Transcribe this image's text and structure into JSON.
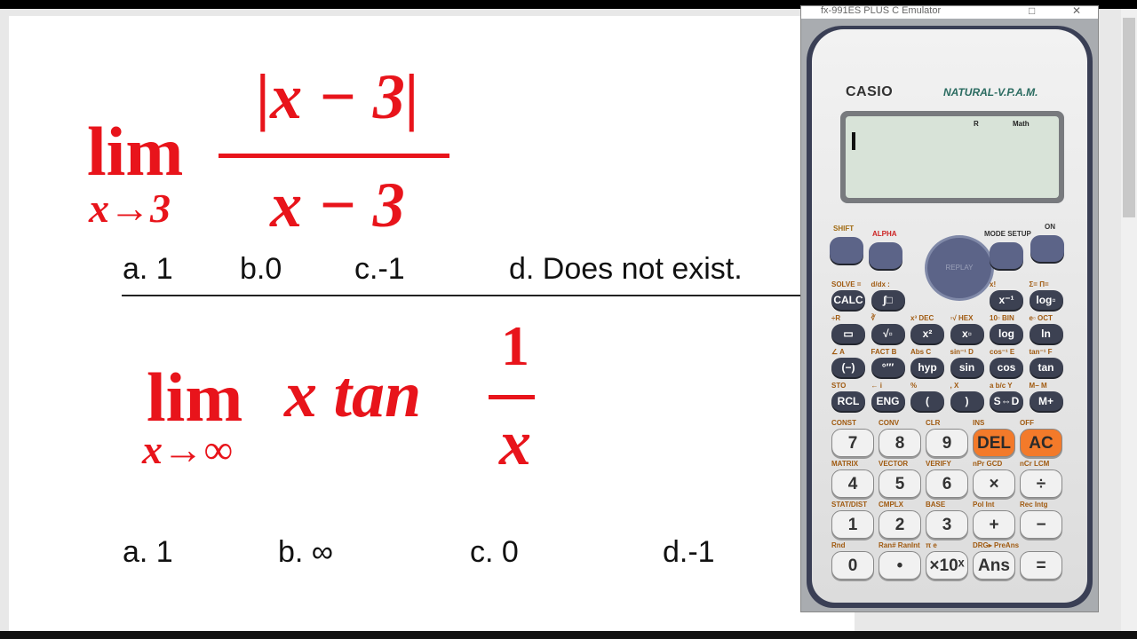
{
  "document": {
    "q1": {
      "lim": "lim",
      "sub": "x→3",
      "numerator": "|x − 3|",
      "denominator": "x − 3",
      "options": [
        "a. 1",
        "b.0",
        "c.-1",
        "d. Does not exist."
      ]
    },
    "q2": {
      "lim": "lim",
      "sub": "x→∞",
      "expr": "x tan",
      "numerator": "1",
      "denominator": "x",
      "options": [
        "a. 1",
        "b. ∞",
        "c. 0",
        "d.-1"
      ]
    },
    "accent_color": "#e8141b"
  },
  "emulator": {
    "title": "fx-991ES PLUS C Emulator",
    "brand": "CASIO",
    "series": "NATURAL-V.P.A.M.",
    "indicators": [
      "R",
      "Math"
    ],
    "top": {
      "shift": "SHIFT",
      "alpha": "ALPHA",
      "mode": "MODE SETUP",
      "on": "ON",
      "replay": "REPLAY"
    },
    "fn_rows": [
      [
        {
          "k": "CALC",
          "s": "SOLVE ="
        },
        {
          "k": "∫□",
          "s": "d/dx :"
        },
        {
          "k": "x⁻¹",
          "s": "x!"
        },
        {
          "k": "log▫",
          "s": "Σ= Π="
        }
      ],
      [
        {
          "k": "▭",
          "s": "÷R"
        },
        {
          "k": "√▫",
          "s": "∛"
        },
        {
          "k": "x²",
          "s": "x³ DEC"
        },
        {
          "k": "x▫",
          "s": "▫√ HEX"
        },
        {
          "k": "log",
          "s": "10▫ BIN"
        },
        {
          "k": "ln",
          "s": "e▫ OCT"
        }
      ],
      [
        {
          "k": "(−)",
          "s": "∠ A"
        },
        {
          "k": "°′″",
          "s": "FACT B"
        },
        {
          "k": "hyp",
          "s": "Abs C"
        },
        {
          "k": "sin",
          "s": "sin⁻¹ D"
        },
        {
          "k": "cos",
          "s": "cos⁻¹ E"
        },
        {
          "k": "tan",
          "s": "tan⁻¹ F"
        }
      ],
      [
        {
          "k": "RCL",
          "s": "STO"
        },
        {
          "k": "ENG",
          "s": "← i"
        },
        {
          "k": "(",
          "s": "%"
        },
        {
          "k": ")",
          "s": ", X"
        },
        {
          "k": "S⇔D",
          "s": "a b/c Y"
        },
        {
          "k": "M+",
          "s": "M− M"
        }
      ]
    ],
    "num_rows": [
      [
        {
          "k": "7",
          "s": "CONST"
        },
        {
          "k": "8",
          "s": "CONV"
        },
        {
          "k": "9",
          "s": "CLR"
        },
        {
          "k": "DEL",
          "s": "INS",
          "o": 1
        },
        {
          "k": "AC",
          "s": "OFF",
          "o": 1
        }
      ],
      [
        {
          "k": "4",
          "s": "MATRIX"
        },
        {
          "k": "5",
          "s": "VECTOR"
        },
        {
          "k": "6",
          "s": "VERIFY"
        },
        {
          "k": "×",
          "s": "nPr GCD"
        },
        {
          "k": "÷",
          "s": "nCr LCM"
        }
      ],
      [
        {
          "k": "1",
          "s": "STAT/DIST"
        },
        {
          "k": "2",
          "s": "CMPLX"
        },
        {
          "k": "3",
          "s": "BASE"
        },
        {
          "k": "+",
          "s": "Pol Int"
        },
        {
          "k": "−",
          "s": "Rec Intg"
        }
      ],
      [
        {
          "k": "0",
          "s": "Rnd"
        },
        {
          "k": "•",
          "s": "Ran# RanInt"
        },
        {
          "k": "×10ˣ",
          "s": "π e"
        },
        {
          "k": "Ans",
          "s": "DRG▸ PreAns"
        },
        {
          "k": "=",
          "s": ""
        }
      ]
    ]
  }
}
